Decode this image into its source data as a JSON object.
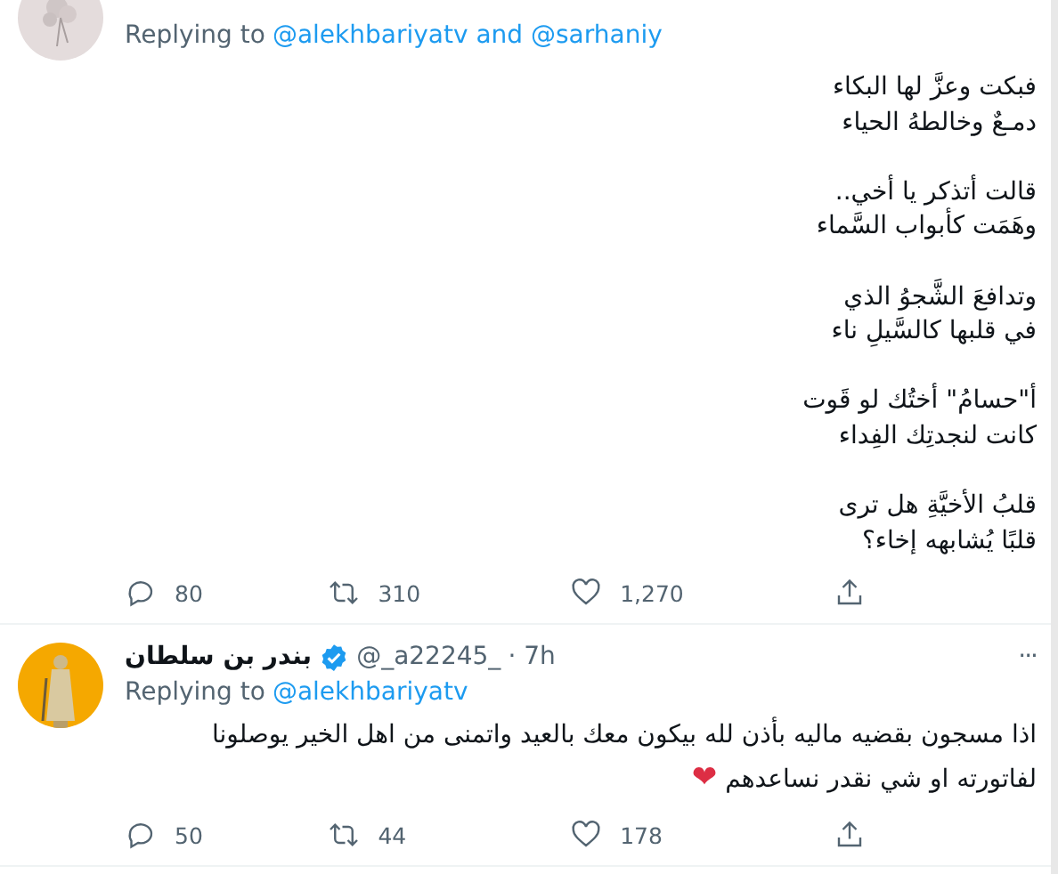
{
  "tweets": [
    {
      "avatar": {
        "color": "#e4dcdc"
      },
      "replying_label": "Replying to",
      "reply_targets": "@alekhbariyatv and @sarhaniy",
      "text": "فبكت وعزَّ لها البكاء\nدمـعٌ وخالطهُ الحياء\n\nقالت أتذكر يا أخي..\nوهَمَت كأبواب السَّماء\n\nوتدافعَ الشَّجوُ الذي\nفي قلبها كالسَّيلِ ناء\n\nأ\"حسامُ\" أختُك لو قَوت\nكانت لنجدتِك الفِداء\n\nقلبُ الأخيَّةِ هل ترى\nقلبًا يُشابهه إخاء؟",
      "actions": {
        "replies": "80",
        "retweets": "310",
        "likes": "1,270"
      }
    },
    {
      "avatar": {
        "color": "#f5a800"
      },
      "name": "بندر بن سلطان",
      "verified": true,
      "handle": "@_a22245_",
      "time": "· 7h",
      "more": "···",
      "replying_label": "Replying to",
      "reply_targets": "@alekhbariyatv",
      "text": "اذا مسجون بقضيه ماليه بأذن لله بيكون معك بالعيد واتمنى من اهل الخير يوصلونا لفاتورته او شي نقدر نساعدهم",
      "emoji": "❤",
      "actions": {
        "replies": "50",
        "retweets": "44",
        "likes": "178"
      }
    }
  ]
}
